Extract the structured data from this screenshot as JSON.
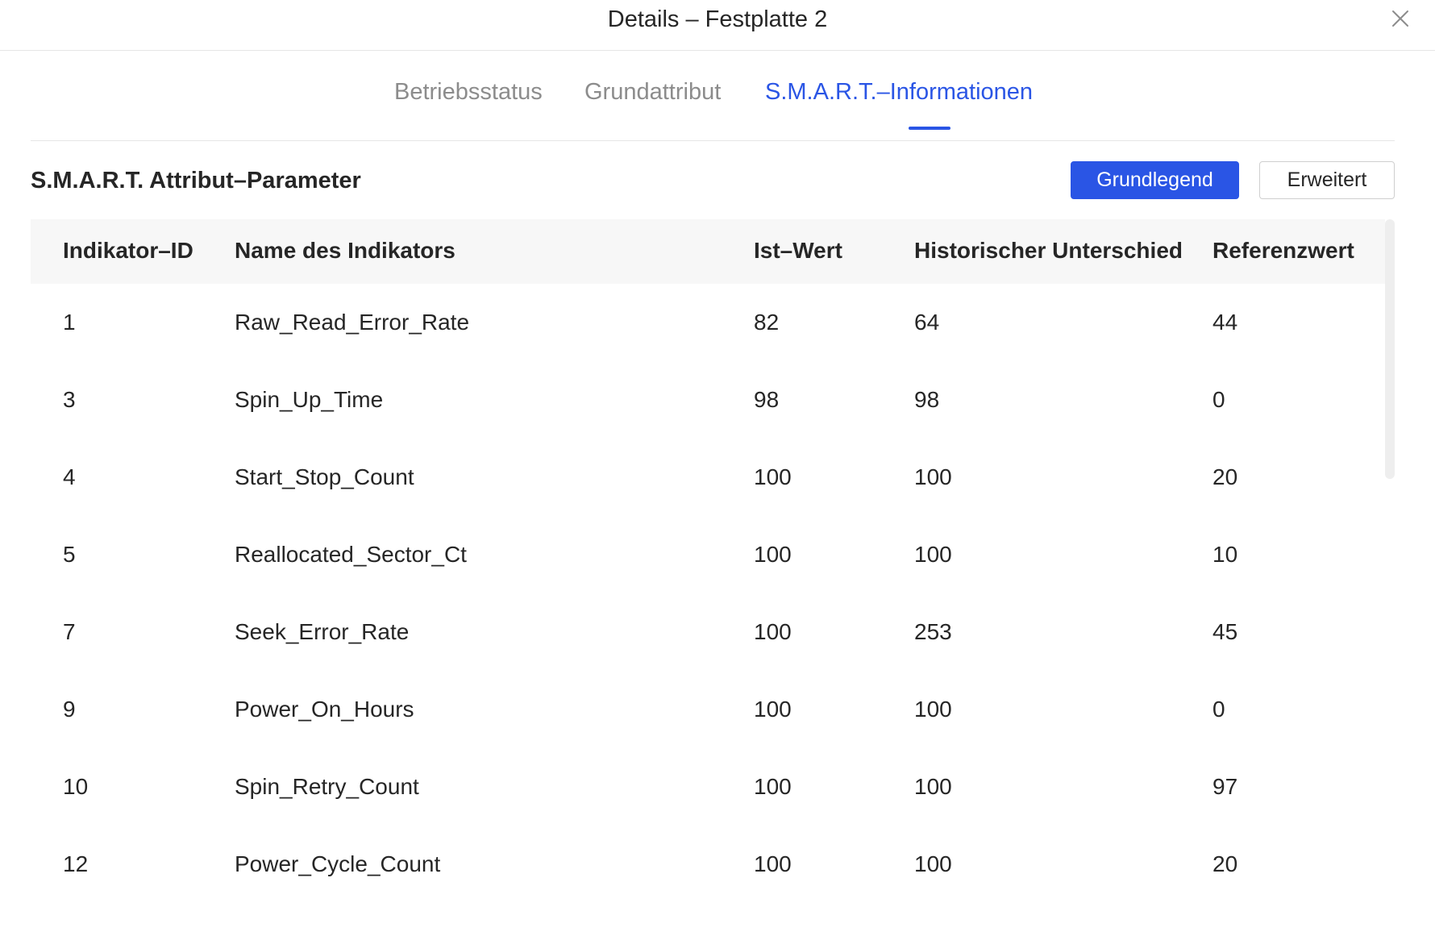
{
  "dialog": {
    "title": "Details – Festplatte 2"
  },
  "tabs": [
    {
      "label": "Betriebsstatus",
      "active": false
    },
    {
      "label": "Grundattribut",
      "active": false
    },
    {
      "label": "S.M.A.R.T.–Informationen",
      "active": true
    }
  ],
  "section": {
    "title": "S.M.A.R.T. Attribut–Parameter",
    "basic_label": "Grundlegend",
    "advanced_label": "Erweitert"
  },
  "table": {
    "columns": [
      "Indikator–ID",
      "Name des Indikators",
      "Ist–Wert",
      "Historischer Unterschied",
      "Referenzwert"
    ],
    "rows": [
      [
        "1",
        "Raw_Read_Error_Rate",
        "82",
        "64",
        "44"
      ],
      [
        "3",
        "Spin_Up_Time",
        "98",
        "98",
        "0"
      ],
      [
        "4",
        "Start_Stop_Count",
        "100",
        "100",
        "20"
      ],
      [
        "5",
        "Reallocated_Sector_Ct",
        "100",
        "100",
        "10"
      ],
      [
        "7",
        "Seek_Error_Rate",
        "100",
        "253",
        "45"
      ],
      [
        "9",
        "Power_On_Hours",
        "100",
        "100",
        "0"
      ],
      [
        "10",
        "Spin_Retry_Count",
        "100",
        "100",
        "97"
      ],
      [
        "12",
        "Power_Cycle_Count",
        "100",
        "100",
        "20"
      ]
    ]
  },
  "colors": {
    "accent": "#2a55e5",
    "header_bg": "#f7f7f7",
    "muted_text": "#8c8c8c"
  },
  "icons": {
    "close": "close-icon"
  }
}
